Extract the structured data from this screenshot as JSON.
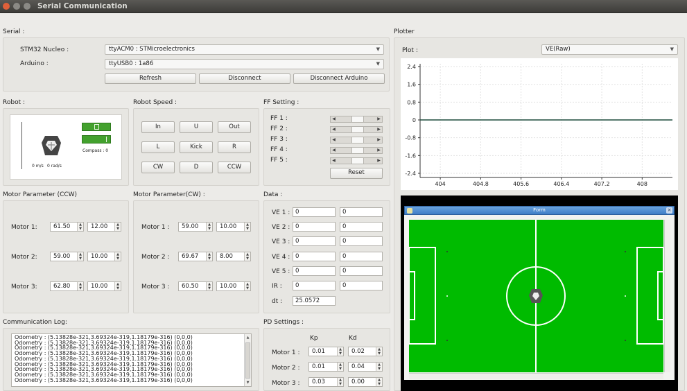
{
  "window": {
    "title": "Serial Communication"
  },
  "serial": {
    "section": "Serial :",
    "stm_label": "STM32 Nucleo :",
    "stm_value": "ttyACM0 : STMicroelectronics",
    "arduino_label": "Arduino :",
    "arduino_value": "ttyUSB0 : 1a86",
    "refresh": "Refresh",
    "disconnect": "Disconnect",
    "disconnect_arduino": "Disconnect Arduino"
  },
  "robot": {
    "section": "Robot :",
    "speed_linear": "0 m/s",
    "speed_angular": "0 rad/s",
    "compass": "Compass : 0"
  },
  "robot_speed": {
    "section": "Robot Speed :",
    "buttons": [
      "In",
      "U",
      "Out",
      "L",
      "Kick",
      "R",
      "CW",
      "D",
      "CCW"
    ]
  },
  "ff": {
    "section": "FF Setting :",
    "labels": [
      "FF 1 :",
      "FF 2 :",
      "FF 3 :",
      "FF 4 :",
      "FF 5 :"
    ],
    "reset": "Reset"
  },
  "motor_ccw": {
    "section": "Motor Parameter (CCW)",
    "rows": [
      {
        "label": "Motor 1:",
        "a": "61.50",
        "b": "12.00"
      },
      {
        "label": "Motor 2:",
        "a": "59.00",
        "b": "10.00"
      },
      {
        "label": "Motor 3:",
        "a": "62.80",
        "b": "10.00"
      }
    ]
  },
  "motor_cw": {
    "section": "Motor Parameter(CW) :",
    "rows": [
      {
        "label": "Motor 1 :",
        "a": "59.00",
        "b": "10.00"
      },
      {
        "label": "Motor 2 :",
        "a": "69.67",
        "b": "8.00"
      },
      {
        "label": "Motor 3 :",
        "a": "60.50",
        "b": "10.00"
      }
    ]
  },
  "data": {
    "section": "Data :",
    "rows": [
      {
        "label": "VE 1 :",
        "a": "0",
        "b": "0"
      },
      {
        "label": "VE 2 :",
        "a": "0",
        "b": "0"
      },
      {
        "label": "VE 3 :",
        "a": "0",
        "b": "0"
      },
      {
        "label": "VE 4 :",
        "a": "0",
        "b": "0"
      },
      {
        "label": "VE 5 :",
        "a": "0",
        "b": "0"
      },
      {
        "label": "IR :",
        "a": "0",
        "b": "0"
      }
    ],
    "dt_label": "dt :",
    "dt_value": "25.0572"
  },
  "log": {
    "section": "Communication Log:",
    "lines": [
      "Odometry : (5.13828e-321,3.69324e-319,1.18179e-316) (0,0,0)",
      "Odometry : (5.13828e-321,3.69324e-319,1.18179e-316) (0,0,0)",
      "Odometry : (5.13828e-321,3.69324e-319,1.18179e-316) (0,0,0)",
      "Odometry : (5.13828e-321,3.69324e-319,1.18179e-316) (0,0,0)",
      "Odometry : (5.13828e-321,3.69324e-319,1.18179e-316) (0,0,0)",
      "Odometry : (5.13828e-321,3.69324e-319,1.18179e-316) (0,0,0)",
      "Odometry : (5.13828e-321,3.69324e-319,1.18179e-316) (0,0,0)",
      "Odometry : (5.13828e-321,3.69324e-319,1.18179e-316) (0,0,0)",
      "Odometry : (5.13828e-321,3.69324e-319,1.18179e-316) (0,0,0)"
    ]
  },
  "pd": {
    "section": "PD Settings :",
    "kp": "Kp",
    "kd": "Kd",
    "rows": [
      {
        "label": "Motor 1 :",
        "kp": "0.01",
        "kd": "0.02"
      },
      {
        "label": "Motor 2 :",
        "kp": "0.01",
        "kd": "0.04"
      },
      {
        "label": "Motor 3 :",
        "kp": "0.03",
        "kd": "0.00"
      }
    ]
  },
  "plotter": {
    "section": "Plotter",
    "plot_label": "Plot :",
    "plot_value": "VE(Raw)"
  },
  "chart_data": {
    "type": "line",
    "x": [
      403.6,
      408.6
    ],
    "series": [
      {
        "values": [
          0,
          0
        ]
      }
    ],
    "xlim": [
      403.6,
      408.6
    ],
    "ylim": [
      -2.4,
      2.4
    ],
    "xticks": [
      "404",
      "404.8",
      "405.6",
      "406.4",
      "407.2",
      "408"
    ],
    "xtick_values": [
      404,
      404.8,
      405.6,
      406.4,
      407.2,
      408
    ],
    "yticks": [
      "2.4",
      "1.6",
      "0.8",
      "0",
      "-0.8",
      "-1.6",
      "-2.4"
    ],
    "ytick_values": [
      2.4,
      1.6,
      0.8,
      0,
      -0.8,
      -1.6,
      -2.4
    ],
    "grid": true
  },
  "field_window": {
    "title": "Form"
  },
  "colors": {
    "field_green": "#00bb00",
    "titlebar": "#4a4946",
    "line_color": "#1b4a3a"
  }
}
